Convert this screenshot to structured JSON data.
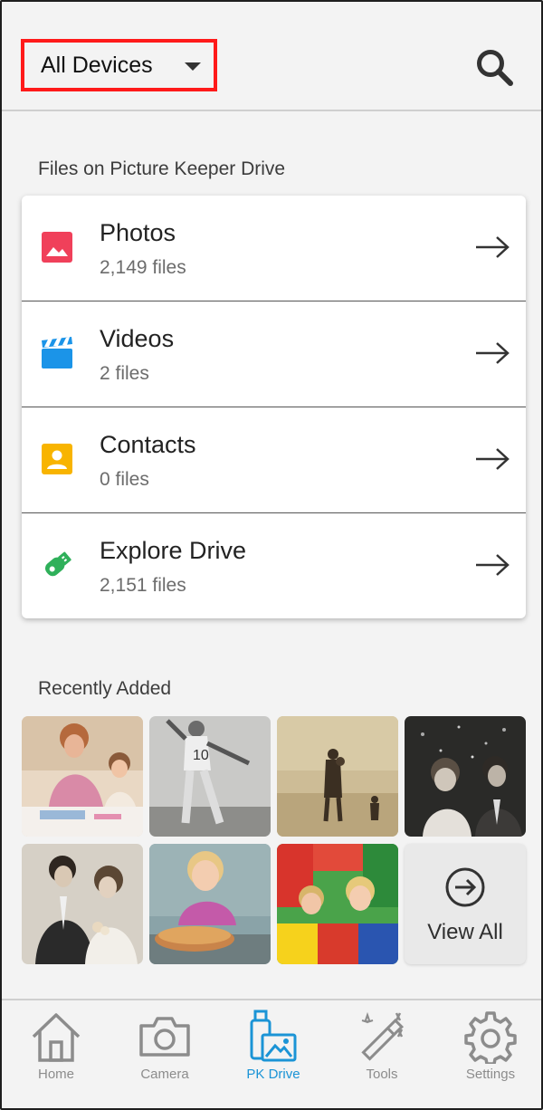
{
  "header": {
    "device_select": "All Devices"
  },
  "files_section": {
    "title": "Files on Picture Keeper Drive",
    "items": [
      {
        "label": "Photos",
        "count": "2,149 files",
        "icon": "photo-icon",
        "color": "#f0405a"
      },
      {
        "label": "Videos",
        "count": "2 files",
        "icon": "clapperboard-icon",
        "color": "#1b94e8"
      },
      {
        "label": "Contacts",
        "count": "0 files",
        "icon": "contact-icon",
        "color": "#f8b400"
      },
      {
        "label": "Explore Drive",
        "count": "2,151 files",
        "icon": "usb-drive-icon",
        "color": "#2fb05a"
      }
    ]
  },
  "recent_section": {
    "title": "Recently Added",
    "thumbnails": [
      "mother-and-child-crafting-photo",
      "vintage-football-player-photo",
      "father-and-child-at-beach-photo",
      "vintage-couple-laughing-photo",
      "vintage-wedding-couple-photo",
      "toddler-with-pie-photo",
      "kids-in-play-area-photo"
    ],
    "view_all": "View All"
  },
  "tabbar": {
    "tabs": [
      {
        "label": "Home",
        "icon": "home-icon",
        "active": false
      },
      {
        "label": "Camera",
        "icon": "camera-icon",
        "active": false
      },
      {
        "label": "PK Drive",
        "icon": "pk-drive-icon",
        "active": true
      },
      {
        "label": "Tools",
        "icon": "magic-wand-icon",
        "active": false
      },
      {
        "label": "Settings",
        "icon": "gear-icon",
        "active": false
      }
    ]
  },
  "colors": {
    "accent": "#1b94d6",
    "highlight_border": "#ff1a1a",
    "inactive_tab": "#8c8c8c"
  }
}
